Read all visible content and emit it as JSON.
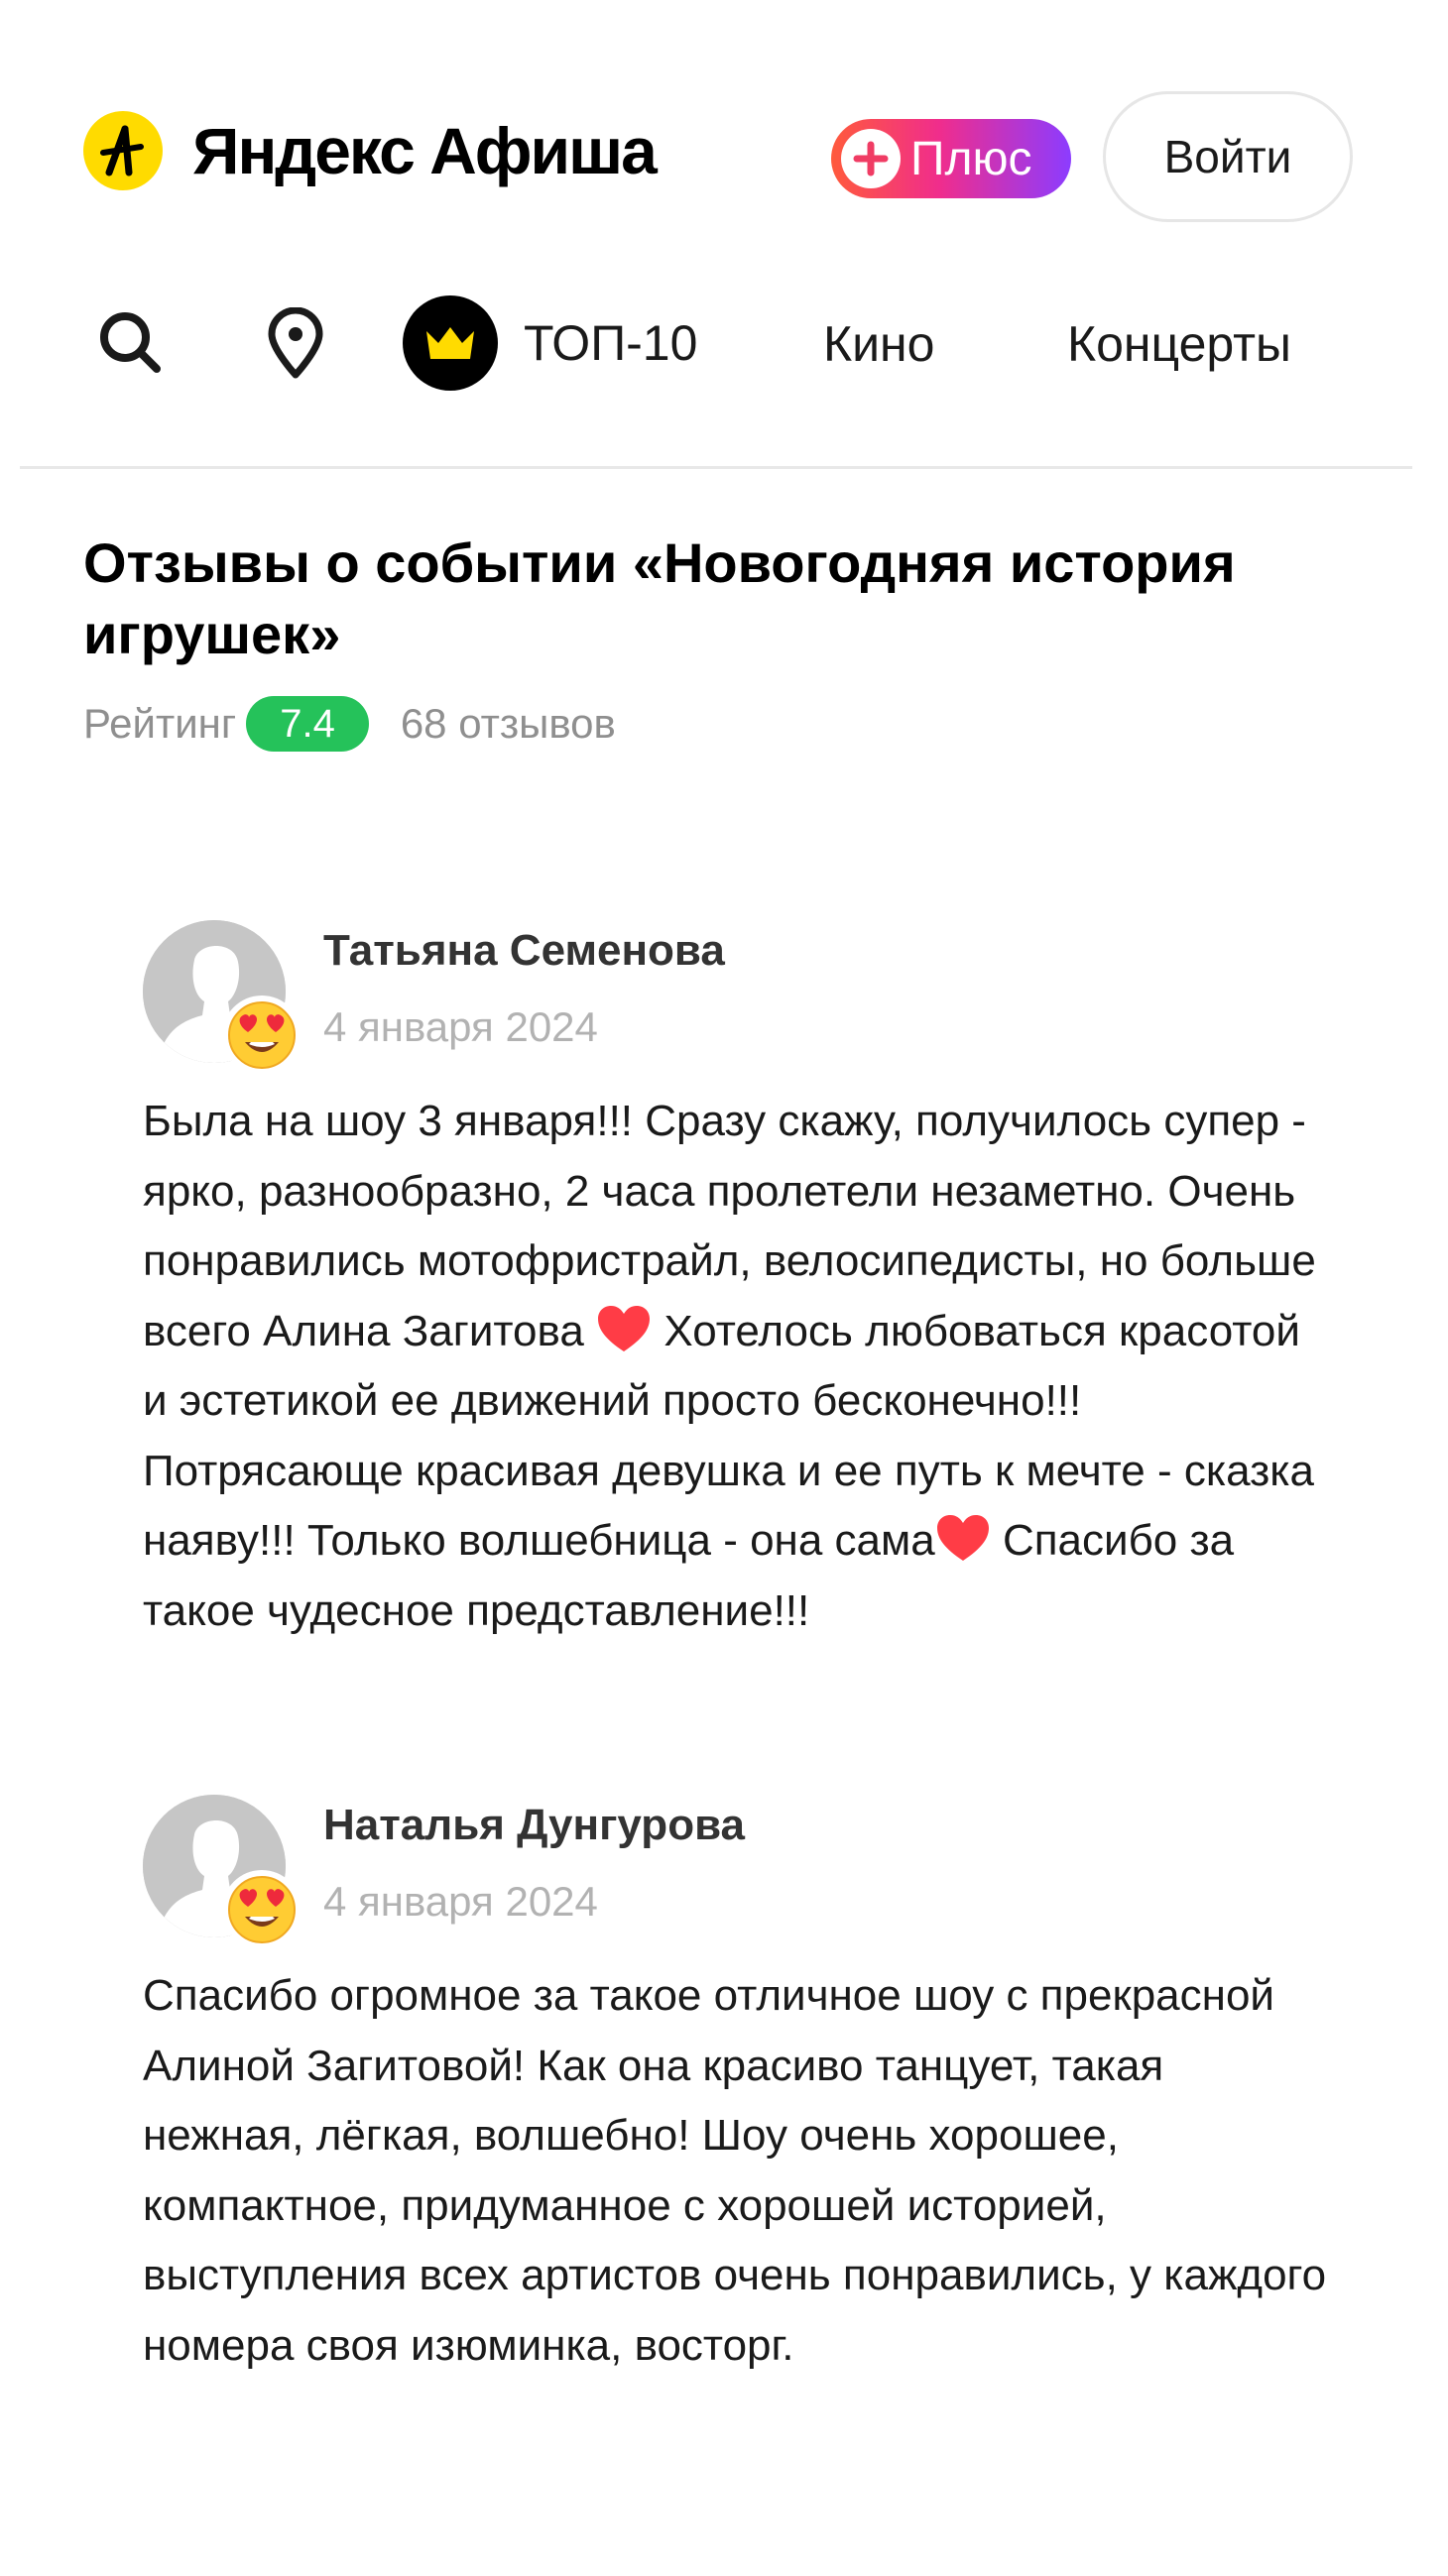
{
  "header": {
    "logo_text": "Яндекс Афиша",
    "plus_label": "Плюс",
    "login_label": "Войти"
  },
  "nav": {
    "top10_label": "ТОП-10",
    "kino_label": "Кино",
    "concerts_label": "Концерты"
  },
  "page": {
    "title": "Отзывы о событии «Новогодняя история игрушек»",
    "rating_label": "Рейтинг",
    "rating_value": "7.4",
    "reviews_count": "68 отзывов"
  },
  "reviews": [
    {
      "author": "Татьяна Семенова",
      "date": "4 января 2024",
      "text_parts": [
        "Была на шоу 3 января!!! Сразу скажу, получилось супер - ярко, разнообразно, 2 часа пролетели незаметно. Очень понравились мотофристрайл, велосипедисты, но больше всего Алина Загитова ",
        " Хотелось любоваться красотой и эстетикой ее движений просто бесконечно!!! Потрясающе красивая девушка и ее путь к мечте - сказка наяву!!! Только волшебница - она сама",
        " Спасибо за такое чудесное представление!!!"
      ]
    },
    {
      "author": "Наталья Дунгурова",
      "date": "4 января 2024",
      "text": "Спасибо огромное за такое отличное шоу с прекрасной Алиной Загитовой! Как она красиво танцует, такая нежная, лёгкая, волшебно! Шоу очень хорошее, компактное, придуманное с хорошей историей, выступления всех артистов очень понравились, у каждого номера своя изюминка, восторг."
    }
  ],
  "colors": {
    "brand_yellow": "#ffdb00",
    "rating_green": "#25c25a",
    "heart_red": "#ff3c46"
  },
  "icons": {
    "logo": "afisha-logo-icon",
    "plus": "plus-icon",
    "search": "search-icon",
    "location": "location-pin-icon",
    "top10": "crown-icon",
    "avatar": "user-silhouette-icon",
    "reaction": "heart-eyes-emoji-icon",
    "heart": "red-heart-emoji-icon"
  }
}
